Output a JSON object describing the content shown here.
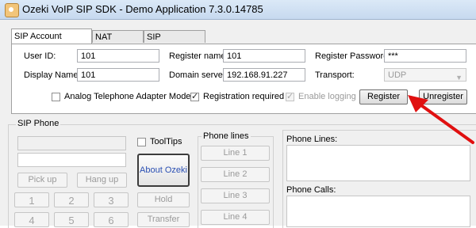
{
  "window": {
    "title": "Ozeki VoIP SIP SDK - Demo Application 7.3.0.14785"
  },
  "tabs": [
    {
      "label": "SIP Account Settings",
      "active": true
    },
    {
      "label": "NAT Settings",
      "active": false
    },
    {
      "label": "SIP Messages",
      "active": false
    }
  ],
  "account": {
    "user_id_label": "User ID:",
    "user_id": "101",
    "register_name_label": "Register name:",
    "register_name": "101",
    "register_password_label": "Register Password:",
    "register_password": "***",
    "display_name_label": "Display Name:",
    "display_name": "101",
    "domain_server_label": "Domain server:",
    "domain_server": "192.168.91.227",
    "transport_label": "Transport:",
    "transport": "UDP",
    "analog_adapter_label": "Analog Telephone Adapter Mode",
    "analog_adapter_checked": false,
    "registration_required_label": "Registration required",
    "registration_required_checked": true,
    "enable_logging_label": "Enable logging",
    "enable_logging_checked": true,
    "register_button": "Register",
    "unregister_button": "Unregister"
  },
  "sip_phone": {
    "group_title": "SIP Phone",
    "tooltips_label": "ToolTips",
    "pickup_button": "Pick up",
    "hangup_button": "Hang up",
    "about_button": "About Ozeki",
    "hold_button": "Hold",
    "transfer_button": "Transfer",
    "keypad": [
      "1",
      "2",
      "3",
      "4",
      "5",
      "6"
    ],
    "phone_lines_title": "Phone lines",
    "lines": [
      "Line 1",
      "Line 2",
      "Line 3",
      "Line 4"
    ],
    "phone_lines_list_label": "Phone Lines:",
    "phone_calls_list_label": "Phone Calls:"
  },
  "colors": {
    "annotation_arrow": "#e01010",
    "about_text": "#2a4fb3"
  }
}
